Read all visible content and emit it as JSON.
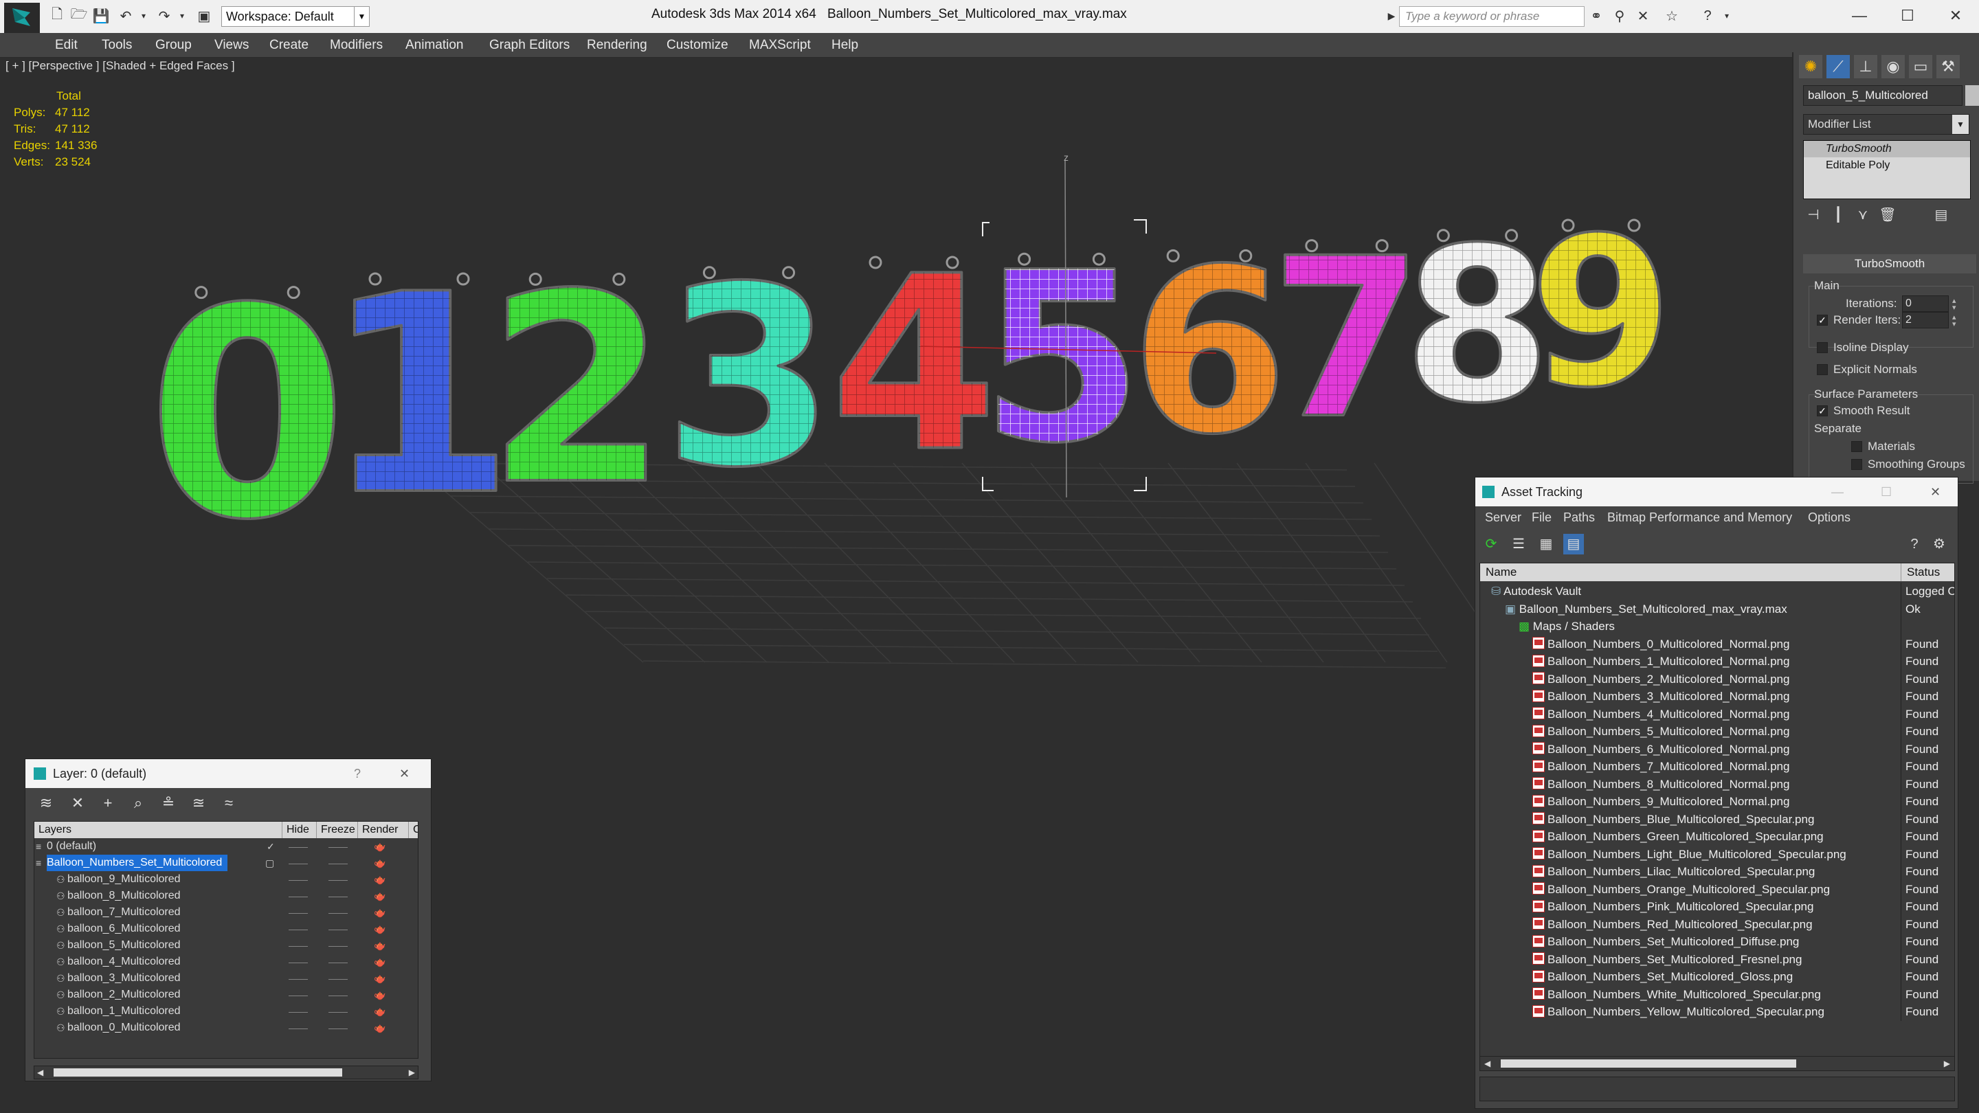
{
  "window": {
    "app_title": "Autodesk 3ds Max  2014 x64",
    "file_title": "Balloon_Numbers_Set_Multicolored_max_vray.max",
    "workspace": "Workspace: Default",
    "search_placeholder": "Type a keyword or phrase"
  },
  "menu": [
    "Edit",
    "Tools",
    "Group",
    "Views",
    "Create",
    "Modifiers",
    "Animation",
    "Graph Editors",
    "Rendering",
    "Customize",
    "MAXScript",
    "Help"
  ],
  "viewport": {
    "label": "[ + ] [Perspective ] [Shaded + Edged Faces ]",
    "stats_header": "Total",
    "stats": [
      {
        "label": "Polys:",
        "value": "47 112"
      },
      {
        "label": "Tris:",
        "value": "47 112"
      },
      {
        "label": "Edges:",
        "value": "141 336"
      },
      {
        "label": "Verts:",
        "value": "23 524"
      }
    ],
    "balloons": [
      {
        "digit": "0",
        "color": "#3fdc3a"
      },
      {
        "digit": "1",
        "color": "#3f5fe0"
      },
      {
        "digit": "2",
        "color": "#3fdc3a"
      },
      {
        "digit": "3",
        "color": "#3fe0b8"
      },
      {
        "digit": "4",
        "color": "#ea3a3a"
      },
      {
        "digit": "5",
        "color": "#8a3cf0"
      },
      {
        "digit": "6",
        "color": "#f08a28"
      },
      {
        "digit": "7",
        "color": "#e23ad8"
      },
      {
        "digit": "8",
        "color": "#f2f2f2"
      },
      {
        "digit": "9",
        "color": "#e8dc2a"
      }
    ]
  },
  "command_panel": {
    "object_name": "balloon_5_Multicolored",
    "modifier_list": "Modifier List",
    "stack": [
      "TurboSmooth",
      "Editable Poly"
    ],
    "rollout_title": "TurboSmooth",
    "main_group": "Main",
    "iterations_label": "Iterations:",
    "iterations_value": "0",
    "render_iters_label": "Render Iters:",
    "render_iters_value": "2",
    "isoline_display": "Isoline Display",
    "explicit_normals": "Explicit Normals",
    "surface_params": "Surface Parameters",
    "smooth_result": "Smooth Result",
    "separate": "Separate",
    "materials": "Materials",
    "smoothing_groups": "Smoothing Groups"
  },
  "layer_window": {
    "title": "Layer: 0 (default)",
    "help": "?",
    "columns": [
      "Layers",
      "Hide",
      "Freeze",
      "Render",
      "C"
    ],
    "rows": [
      {
        "name": "0 (default)",
        "level": 0,
        "selected": false
      },
      {
        "name": "Balloon_Numbers_Set_Multicolored",
        "level": 0,
        "selected": true
      },
      {
        "name": "balloon_9_Multicolored",
        "level": 1,
        "selected": false
      },
      {
        "name": "balloon_8_Multicolored",
        "level": 1,
        "selected": false
      },
      {
        "name": "balloon_7_Multicolored",
        "level": 1,
        "selected": false
      },
      {
        "name": "balloon_6_Multicolored",
        "level": 1,
        "selected": false
      },
      {
        "name": "balloon_5_Multicolored",
        "level": 1,
        "selected": false
      },
      {
        "name": "balloon_4_Multicolored",
        "level": 1,
        "selected": false
      },
      {
        "name": "balloon_3_Multicolored",
        "level": 1,
        "selected": false
      },
      {
        "name": "balloon_2_Multicolored",
        "level": 1,
        "selected": false
      },
      {
        "name": "balloon_1_Multicolored",
        "level": 1,
        "selected": false
      },
      {
        "name": "balloon_0_Multicolored",
        "level": 1,
        "selected": false
      }
    ]
  },
  "asset_window": {
    "title": "Asset Tracking",
    "menu": [
      "Server",
      "File",
      "Paths",
      "Bitmap Performance and Memory",
      "Options"
    ],
    "col_name": "Name",
    "col_status": "Status",
    "rows": [
      {
        "name": "Autodesk Vault",
        "status": "Logged O",
        "level": 0,
        "icon": "vault"
      },
      {
        "name": "Balloon_Numbers_Set_Multicolored_max_vray.max",
        "status": "Ok",
        "level": 1,
        "icon": "max"
      },
      {
        "name": "Maps / Shaders",
        "status": "",
        "level": 2,
        "icon": "maps"
      },
      {
        "name": "Balloon_Numbers_0_Multicolored_Normal.png",
        "status": "Found",
        "level": 3,
        "icon": "png"
      },
      {
        "name": "Balloon_Numbers_1_Multicolored_Normal.png",
        "status": "Found",
        "level": 3,
        "icon": "png"
      },
      {
        "name": "Balloon_Numbers_2_Multicolored_Normal.png",
        "status": "Found",
        "level": 3,
        "icon": "png"
      },
      {
        "name": "Balloon_Numbers_3_Multicolored_Normal.png",
        "status": "Found",
        "level": 3,
        "icon": "png"
      },
      {
        "name": "Balloon_Numbers_4_Multicolored_Normal.png",
        "status": "Found",
        "level": 3,
        "icon": "png"
      },
      {
        "name": "Balloon_Numbers_5_Multicolored_Normal.png",
        "status": "Found",
        "level": 3,
        "icon": "png"
      },
      {
        "name": "Balloon_Numbers_6_Multicolored_Normal.png",
        "status": "Found",
        "level": 3,
        "icon": "png"
      },
      {
        "name": "Balloon_Numbers_7_Multicolored_Normal.png",
        "status": "Found",
        "level": 3,
        "icon": "png"
      },
      {
        "name": "Balloon_Numbers_8_Multicolored_Normal.png",
        "status": "Found",
        "level": 3,
        "icon": "png"
      },
      {
        "name": "Balloon_Numbers_9_Multicolored_Normal.png",
        "status": "Found",
        "level": 3,
        "icon": "png"
      },
      {
        "name": "Balloon_Numbers_Blue_Multicolored_Specular.png",
        "status": "Found",
        "level": 3,
        "icon": "png"
      },
      {
        "name": "Balloon_Numbers_Green_Multicolored_Specular.png",
        "status": "Found",
        "level": 3,
        "icon": "png"
      },
      {
        "name": "Balloon_Numbers_Light_Blue_Multicolored_Specular.png",
        "status": "Found",
        "level": 3,
        "icon": "png"
      },
      {
        "name": "Balloon_Numbers_Lilac_Multicolored_Specular.png",
        "status": "Found",
        "level": 3,
        "icon": "png"
      },
      {
        "name": "Balloon_Numbers_Orange_Multicolored_Specular.png",
        "status": "Found",
        "level": 3,
        "icon": "png"
      },
      {
        "name": "Balloon_Numbers_Pink_Multicolored_Specular.png",
        "status": "Found",
        "level": 3,
        "icon": "png"
      },
      {
        "name": "Balloon_Numbers_Red_Multicolored_Specular.png",
        "status": "Found",
        "level": 3,
        "icon": "png"
      },
      {
        "name": "Balloon_Numbers_Set_Multicolored_Diffuse.png",
        "status": "Found",
        "level": 3,
        "icon": "png"
      },
      {
        "name": "Balloon_Numbers_Set_Multicolored_Fresnel.png",
        "status": "Found",
        "level": 3,
        "icon": "png"
      },
      {
        "name": "Balloon_Numbers_Set_Multicolored_Gloss.png",
        "status": "Found",
        "level": 3,
        "icon": "png"
      },
      {
        "name": "Balloon_Numbers_White_Multicolored_Specular.png",
        "status": "Found",
        "level": 3,
        "icon": "png"
      },
      {
        "name": "Balloon_Numbers_Yellow_Multicolored_Specular.png",
        "status": "Found",
        "level": 3,
        "icon": "png"
      }
    ]
  }
}
